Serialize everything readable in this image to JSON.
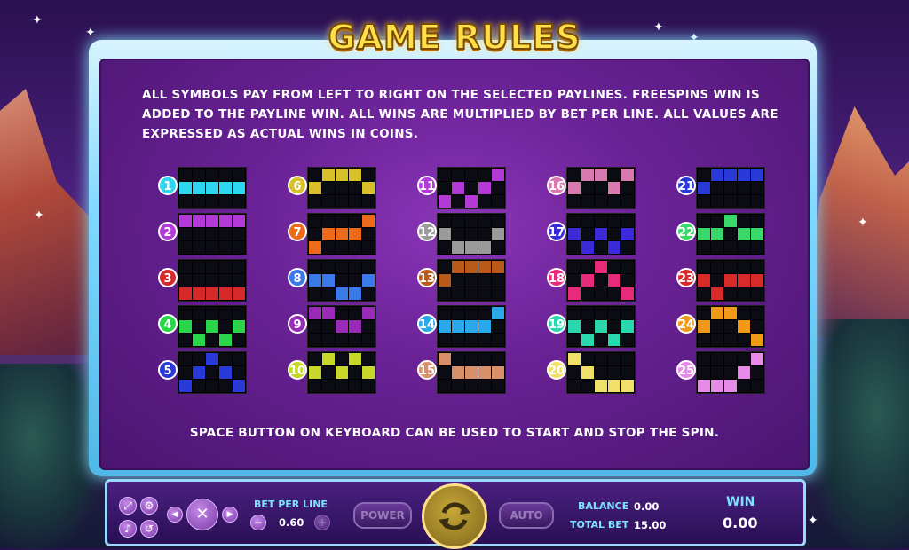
{
  "title": "GAME RULES",
  "rules_text": "ALL SYMBOLS PAY FROM LEFT TO RIGHT ON THE SELECTED PAYLINES. FREESPINS WIN IS ADDED TO THE PAYLINE WIN. ALL WINS ARE MULTIPLIED BY BET PER LINE. ALL VALUES ARE EXPRESSED AS ACTUAL WINS IN COINS.",
  "footer_note": "SPACE  BUTTON ON KEYBOARD CAN BE USED TO START AND STOP THE SPIN.",
  "controls": {
    "bet_per_line_label": "BET PER LINE",
    "bet_per_line_value": "0.60",
    "power_label": "POWER",
    "auto_label": "AUTO",
    "balance_label": "BALANCE",
    "balance_value": "0.00",
    "total_bet_label": "TOTAL BET",
    "total_bet_value": "15.00",
    "win_label": "WIN",
    "win_value": "0.00",
    "minus_symbol": "−",
    "plus_symbol": "+",
    "close_symbol": "✕",
    "prev_symbol": "◀",
    "next_symbol": "▶"
  },
  "paylines": [
    {
      "n": "1",
      "color": "#2fd6f0",
      "rows": [
        1,
        1,
        1,
        1,
        1
      ]
    },
    {
      "n": "2",
      "color": "#b43ad8",
      "rows": [
        0,
        0,
        0,
        0,
        0
      ]
    },
    {
      "n": "3",
      "color": "#d62a2a",
      "rows": [
        2,
        2,
        2,
        2,
        2
      ]
    },
    {
      "n": "4",
      "color": "#2ad64a",
      "rows": [
        1,
        2,
        1,
        2,
        1
      ]
    },
    {
      "n": "5",
      "color": "#2a3ad8",
      "rows": [
        2,
        1,
        0,
        1,
        2
      ]
    },
    {
      "n": "6",
      "color": "#d8c02a",
      "rows": [
        1,
        0,
        0,
        0,
        1
      ]
    },
    {
      "n": "7",
      "color": "#ec6a1a",
      "rows": [
        2,
        1,
        1,
        1,
        0
      ]
    },
    {
      "n": "8",
      "color": "#3a7ae8",
      "rows": [
        1,
        1,
        2,
        2,
        1
      ]
    },
    {
      "n": "9",
      "color": "#9a2ab8",
      "rows": [
        0,
        0,
        1,
        1,
        0
      ]
    },
    {
      "n": "10",
      "color": "#c8d82a",
      "rows": [
        1,
        0,
        1,
        0,
        1
      ]
    },
    {
      "n": "11",
      "color": "#b43ad8",
      "rows": [
        2,
        1,
        2,
        1,
        0
      ]
    },
    {
      "n": "12",
      "color": "#9a9a9a",
      "rows": [
        1,
        2,
        2,
        2,
        1
      ]
    },
    {
      "n": "13",
      "color": "#b85a1a",
      "rows": [
        1,
        0,
        0,
        0,
        0
      ]
    },
    {
      "n": "14",
      "color": "#2aa8e8",
      "rows": [
        1,
        1,
        1,
        1,
        0
      ]
    },
    {
      "n": "15",
      "color": "#d8906a",
      "rows": [
        0,
        1,
        1,
        1,
        1
      ]
    },
    {
      "n": "16",
      "color": "#d87ab0",
      "rows": [
        1,
        0,
        0,
        1,
        0
      ]
    },
    {
      "n": "17",
      "color": "#3a2ad8",
      "rows": [
        1,
        2,
        1,
        2,
        1
      ]
    },
    {
      "n": "18",
      "color": "#e82a7a",
      "rows": [
        2,
        1,
        0,
        1,
        2
      ]
    },
    {
      "n": "19",
      "color": "#2ad8b0",
      "rows": [
        1,
        2,
        1,
        2,
        1
      ]
    },
    {
      "n": "20",
      "color": "#f0e06a",
      "rows": [
        0,
        1,
        2,
        2,
        2
      ]
    },
    {
      "n": "21",
      "color": "#2a3ad8",
      "rows": [
        1,
        0,
        0,
        0,
        0
      ]
    },
    {
      "n": "22",
      "color": "#3ad86a",
      "rows": [
        1,
        1,
        0,
        1,
        1
      ]
    },
    {
      "n": "23",
      "color": "#d82a2a",
      "rows": [
        1,
        2,
        1,
        1,
        1
      ]
    },
    {
      "n": "24",
      "color": "#f09a1a",
      "rows": [
        1,
        0,
        0,
        1,
        2
      ]
    },
    {
      "n": "25",
      "color": "#e88ae8",
      "rows": [
        2,
        2,
        2,
        1,
        0
      ]
    }
  ]
}
